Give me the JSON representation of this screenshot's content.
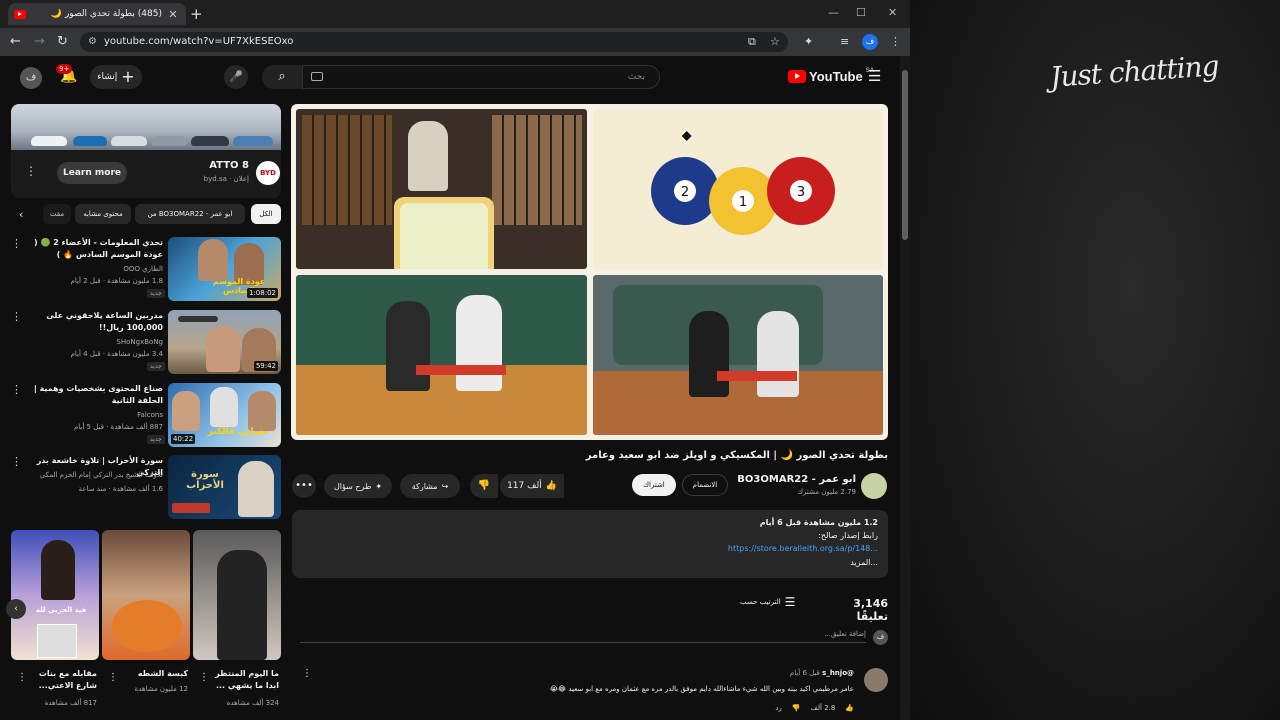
{
  "browser": {
    "tab_title": "(485) بطولة تحدي الصور 🌙",
    "new_tab": "+",
    "url": "youtube.com/watch?v=UF7XkESEOxo",
    "window_controls": [
      "—",
      "☐",
      "✕"
    ]
  },
  "header": {
    "avatar_letter": "ف",
    "notif_count": "9+",
    "create_label": "إنشاء",
    "search_placeholder": "بحث",
    "logo_text": "YouTube",
    "logo_country": "SA"
  },
  "ad": {
    "learn_more": "Learn more",
    "name": "ATTO 8",
    "sub": "byd.sa · إعلان",
    "logo": "BYD"
  },
  "chips": [
    {
      "label": "الكل",
      "active": true
    },
    {
      "label": "من BO3OMAR22 - ابو عمر",
      "active": false
    },
    {
      "label": "محتوى مشابه",
      "active": false
    },
    {
      "label": "مقت",
      "active": false
    }
  ],
  "side_videos": [
    {
      "title": "تحدي المعلومات - الأعضاء 2 🟢 ( عودة الموسم السادس 🔥 )",
      "channel": "الطاري OOO",
      "meta": "1.8 مليون مشاهدة · قبل 2 أيام",
      "duration": "1:08:02",
      "new": "جديد",
      "thumb_text": "عودة الموسم السادس"
    },
    {
      "title": "مدربين الساعة يلاحقوني على 100,000 ريال!!",
      "channel": "SHoNgxBoNg",
      "meta": "3.4 مليون مشاهدة · قبل 4 أيام",
      "duration": "59:42",
      "new": "جديد",
      "thumb_text": ""
    },
    {
      "title": "صناع المحتوى بشخصيات وهمية | الحلقة الثانية",
      "channel": "Falcons",
      "meta": "887 ألف مشاهدة · قبل 5 أيام",
      "duration": "40:22",
      "new": "جديد",
      "thumb_text": "مترابي فالكنز"
    },
    {
      "title": "سورة الأحزاب | تلاوة خاشعة بدر التركي",
      "channel": "تلاوات الشيخ بدر التركي إمام الحرم المكي",
      "meta": "1.6 ألف مشاهدة · منذ ساعة",
      "duration": "",
      "new": "",
      "thumb_text": "سورة الأحزاب"
    }
  ],
  "shorts": [
    {
      "title": "مقابله مع بنات شارع الاعتي...",
      "views": "817 ألف مشاهدة",
      "overlay": "فيد الحربي لله"
    },
    {
      "title": "كبسة الشطه",
      "views": "12 مليون مشاهدة",
      "overlay": ""
    },
    {
      "title": "ما اليوم المنتظر ابدا ما يشهي ...",
      "views": "324 ألف مشاهدة",
      "overlay": ""
    }
  ],
  "video": {
    "title": "بطولة تحدي الصور 🌙 | المكسيكي و اويلز ضد ابو سعيد وعامر",
    "channel": "ابو عمر - BO3OMAR22",
    "subs": "2.79 مليون مشترك",
    "join": "الانضمام",
    "subscribe": "اشتراك",
    "likes": "117 ألف",
    "share": "مشاركة",
    "ask": "طرح سؤال"
  },
  "description": {
    "stats": "1.2 مليون مشاهدة  قبل 6 أيام",
    "line1": "رابط إصدار صالح:",
    "link": "https://store.beralleith.org.sa/p/148...",
    "more": "...المزيد"
  },
  "comments": {
    "count": "3,146 تعليقًا",
    "sort": "الترتيب حسب",
    "add_placeholder": "إضافة تعليق...",
    "add_avatar": "ف",
    "first": {
      "author": "@s_hnjo",
      "time": "قبل 6 أيام",
      "text": "عامر مرطيمي اكيد بينه وبين الله شيء ماشاءالله دايم موفق بالدر مره مع عثمان ومره مع ابو سعيد 😂😭",
      "likes": "2.8 ألف",
      "reply": "رد"
    }
  },
  "overlay_text": "Just chatting",
  "player_panels": {
    "balls": [
      "2",
      "1",
      "3"
    ]
  }
}
